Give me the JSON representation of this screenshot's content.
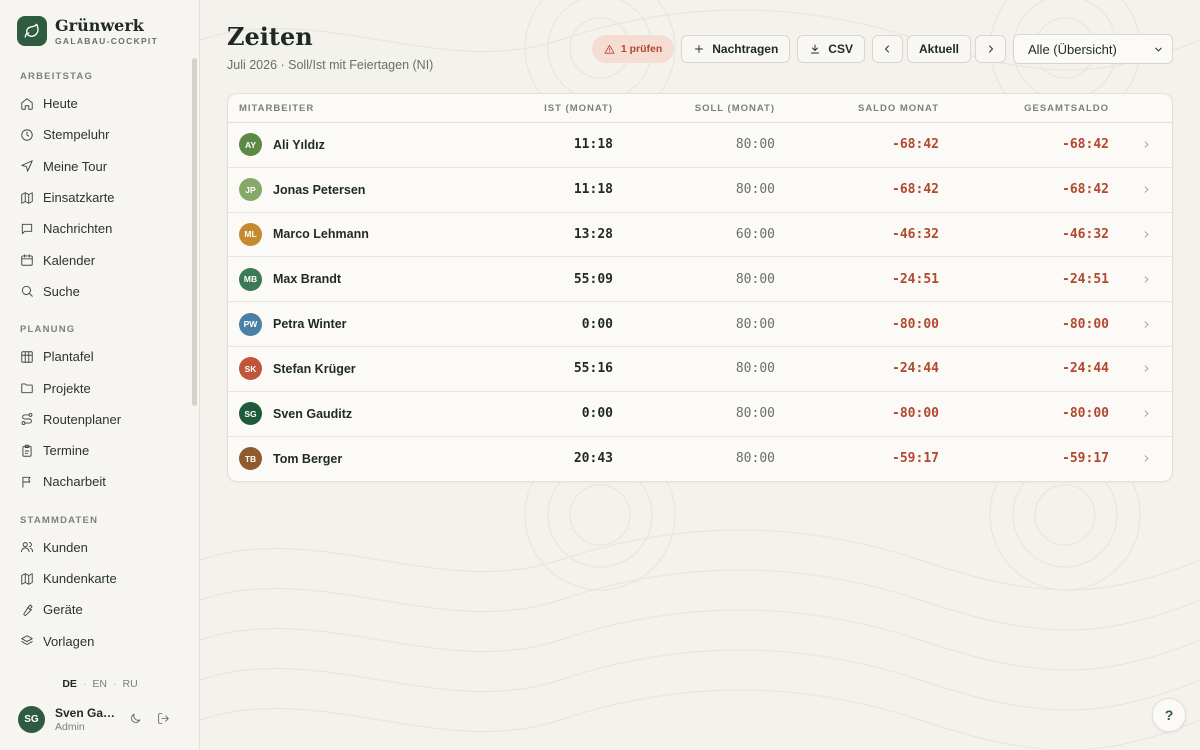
{
  "brand": {
    "name": "Grünwerk",
    "subtitle": "GALABAU-COCKPIT"
  },
  "sidebar": {
    "sections": [
      {
        "title": "ARBEITSTAG",
        "items": [
          {
            "label": "Heute",
            "icon": "home-icon"
          },
          {
            "label": "Stempeluhr",
            "icon": "clock-icon"
          },
          {
            "label": "Meine Tour",
            "icon": "navigation-icon"
          },
          {
            "label": "Einsatzkarte",
            "icon": "map-icon"
          },
          {
            "label": "Nachrichten",
            "icon": "message-icon"
          },
          {
            "label": "Kalender",
            "icon": "calendar-icon"
          },
          {
            "label": "Suche",
            "icon": "search-icon"
          }
        ]
      },
      {
        "title": "PLANUNG",
        "items": [
          {
            "label": "Plantafel",
            "icon": "grid-icon"
          },
          {
            "label": "Projekte",
            "icon": "folder-icon"
          },
          {
            "label": "Routenplaner",
            "icon": "route-icon"
          },
          {
            "label": "Termine",
            "icon": "clipboard-icon"
          },
          {
            "label": "Nacharbeit",
            "icon": "flag-icon"
          }
        ]
      },
      {
        "title": "STAMMDATEN",
        "items": [
          {
            "label": "Kunden",
            "icon": "users-icon"
          },
          {
            "label": "Kundenkarte",
            "icon": "map-icon"
          },
          {
            "label": "Geräte",
            "icon": "wrench-icon"
          },
          {
            "label": "Vorlagen",
            "icon": "layers-icon"
          }
        ]
      }
    ],
    "languages": [
      "DE",
      "EN",
      "RU"
    ],
    "active_language": "DE",
    "user": {
      "initials": "SG",
      "name": "Sven Gauditz",
      "role": "Admin"
    }
  },
  "page": {
    "title": "Zeiten",
    "subtitle": "Juli 2026 · Soll/Ist mit Feiertagen (NI)"
  },
  "toolbar": {
    "warning_label": "1 prüfen",
    "add_label": "Nachtragen",
    "csv_label": "CSV",
    "current_label": "Aktuell",
    "filter_value": "Alle (Übersicht)"
  },
  "table": {
    "headers": {
      "name": "MITARBEITER",
      "ist": "IST (MONAT)",
      "soll": "SOLL (MONAT)",
      "saldo": "SALDO MONAT",
      "total": "GESAMTSALDO"
    },
    "rows": [
      {
        "initials": "AY",
        "name": "Ali Yıldız",
        "color": "#5b8a45",
        "ist": "11:18",
        "soll": "80:00",
        "saldo": "-68:42",
        "total": "-68:42"
      },
      {
        "initials": "JP",
        "name": "Jonas Petersen",
        "color": "#86a86a",
        "ist": "11:18",
        "soll": "80:00",
        "saldo": "-68:42",
        "total": "-68:42"
      },
      {
        "initials": "ML",
        "name": "Marco Lehmann",
        "color": "#c48a2e",
        "ist": "13:28",
        "soll": "60:00",
        "saldo": "-46:32",
        "total": "-46:32"
      },
      {
        "initials": "MB",
        "name": "Max Brandt",
        "color": "#3a7a55",
        "ist": "55:09",
        "soll": "80:00",
        "saldo": "-24:51",
        "total": "-24:51"
      },
      {
        "initials": "PW",
        "name": "Petra Winter",
        "color": "#4a7fa6",
        "ist": "0:00",
        "soll": "80:00",
        "saldo": "-80:00",
        "total": "-80:00"
      },
      {
        "initials": "SK",
        "name": "Stefan Krüger",
        "color": "#c0553b",
        "ist": "55:16",
        "soll": "80:00",
        "saldo": "-24:44",
        "total": "-24:44"
      },
      {
        "initials": "SG",
        "name": "Sven Gauditz",
        "color": "#1f5a3a",
        "ist": "0:00",
        "soll": "80:00",
        "saldo": "-80:00",
        "total": "-80:00"
      },
      {
        "initials": "TB",
        "name": "Tom Berger",
        "color": "#8e5a2e",
        "ist": "20:43",
        "soll": "80:00",
        "saldo": "-59:17",
        "total": "-59:17"
      }
    ]
  },
  "help": {
    "label": "?"
  },
  "colors": {
    "accent": "#2f5b41",
    "negative": "#b3472f",
    "background": "#f4f2ec"
  }
}
